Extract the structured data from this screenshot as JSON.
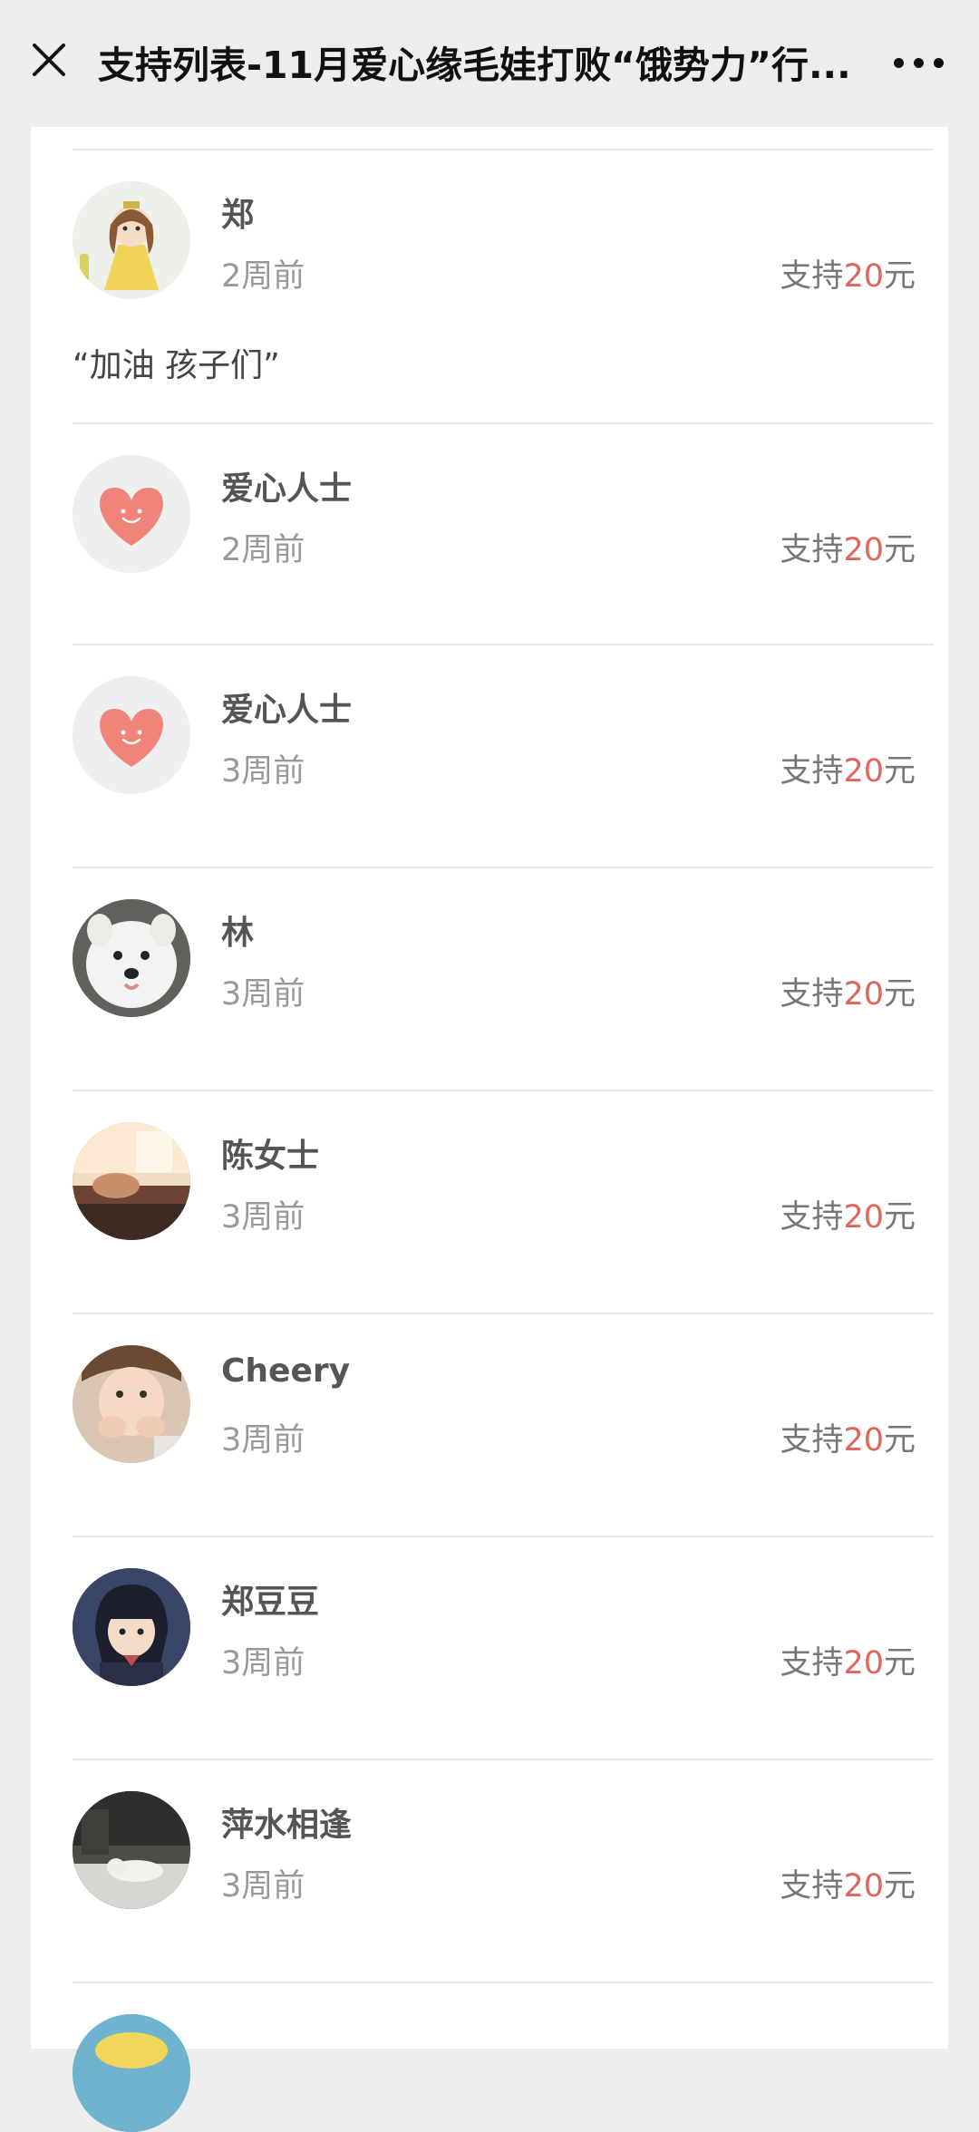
{
  "header": {
    "title": "支持列表-11月爱心缘毛娃打败“饿势力”行..."
  },
  "supporters": [
    {
      "name": "郑",
      "time": "2周前",
      "amount_prefix": "支持",
      "amount": "20",
      "amount_suffix": "元",
      "message": "“加油 孩子们”",
      "avatar": "princess-avatar"
    },
    {
      "name": "爱心人士",
      "time": "2周前",
      "amount_prefix": "支持",
      "amount": "20",
      "amount_suffix": "元",
      "avatar": "heart-avatar"
    },
    {
      "name": "爱心人士",
      "time": "3周前",
      "amount_prefix": "支持",
      "amount": "20",
      "amount_suffix": "元",
      "avatar": "heart-avatar"
    },
    {
      "name": "林",
      "time": "3周前",
      "amount_prefix": "支持",
      "amount": "20",
      "amount_suffix": "元",
      "avatar": "white-dog-avatar"
    },
    {
      "name": "陈女士",
      "time": "3周前",
      "amount_prefix": "支持",
      "amount": "20",
      "amount_suffix": "元",
      "avatar": "bedroom-photo-avatar"
    },
    {
      "name": "Cheery",
      "time": "3周前",
      "amount_prefix": "支持",
      "amount": "20",
      "amount_suffix": "元",
      "avatar": "child-photo-avatar"
    },
    {
      "name": "郑豆豆",
      "time": "3周前",
      "amount_prefix": "支持",
      "amount": "20",
      "amount_suffix": "元",
      "avatar": "anime-girl-avatar"
    },
    {
      "name": "萍水相逢",
      "time": "3周前",
      "amount_prefix": "支持",
      "amount": "20",
      "amount_suffix": "元",
      "avatar": "cat-photo-avatar"
    }
  ],
  "colors": {
    "amount_highlight": "#e0655c",
    "background": "#ededed",
    "card": "#ffffff"
  }
}
